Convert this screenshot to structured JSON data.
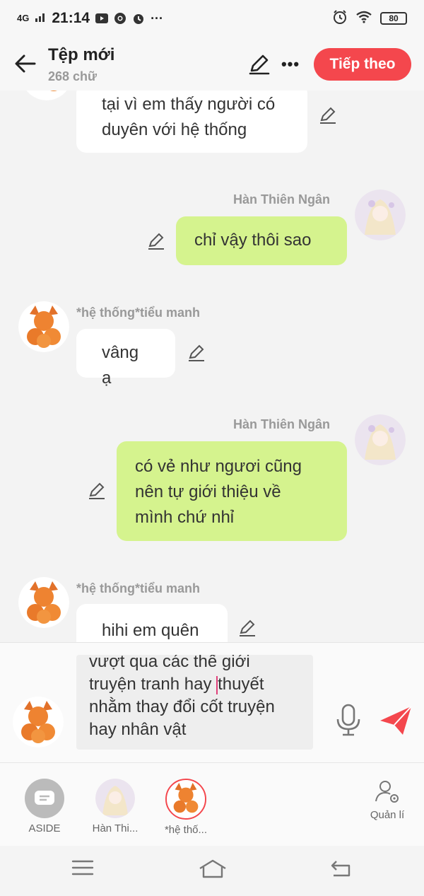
{
  "status_bar": {
    "network": "4G",
    "time": "21:14",
    "battery": "80"
  },
  "header": {
    "title": "Tệp mới",
    "word_count": "268 chữ",
    "next_label": "Tiếp theo"
  },
  "messages": [
    {
      "side": "left",
      "lines": [
        "tại vì em thấy người có",
        "duyên với hệ thống"
      ]
    },
    {
      "side": "right",
      "sender": "Hàn Thiên Ngân",
      "lines": [
        "chỉ vậy thôi sao"
      ]
    },
    {
      "side": "left",
      "sender": "*hệ thống*tiểu manh",
      "lines": [
        "vâng ạ"
      ]
    },
    {
      "side": "right",
      "sender": "Hàn Thiên Ngân",
      "lines": [
        "có vẻ như ngươi cũng",
        "nên tự giới thiệu về",
        "mình chứ nhỉ"
      ]
    },
    {
      "side": "left",
      "sender": "*hệ thống*tiểu manh",
      "lines": [
        "hihi em quên"
      ]
    }
  ],
  "composer": {
    "lines": [
      "vượt qua các thế giới",
      "truyện tranh hay",
      "thuyết",
      "nhằm thay đổi cốt truyện",
      "hay nhân vật"
    ]
  },
  "characters": [
    {
      "label": "ASIDE",
      "icon": "aside-chat-icon"
    },
    {
      "label": "Hàn Thi...",
      "icon": "avatar"
    },
    {
      "label": "*hệ thố...",
      "icon": "avatar"
    }
  ],
  "manage_label": "Quản lí",
  "colors": {
    "accent": "#f4474d",
    "right_bubble": "#d5f38e",
    "left_bubble": "#ffffff"
  }
}
